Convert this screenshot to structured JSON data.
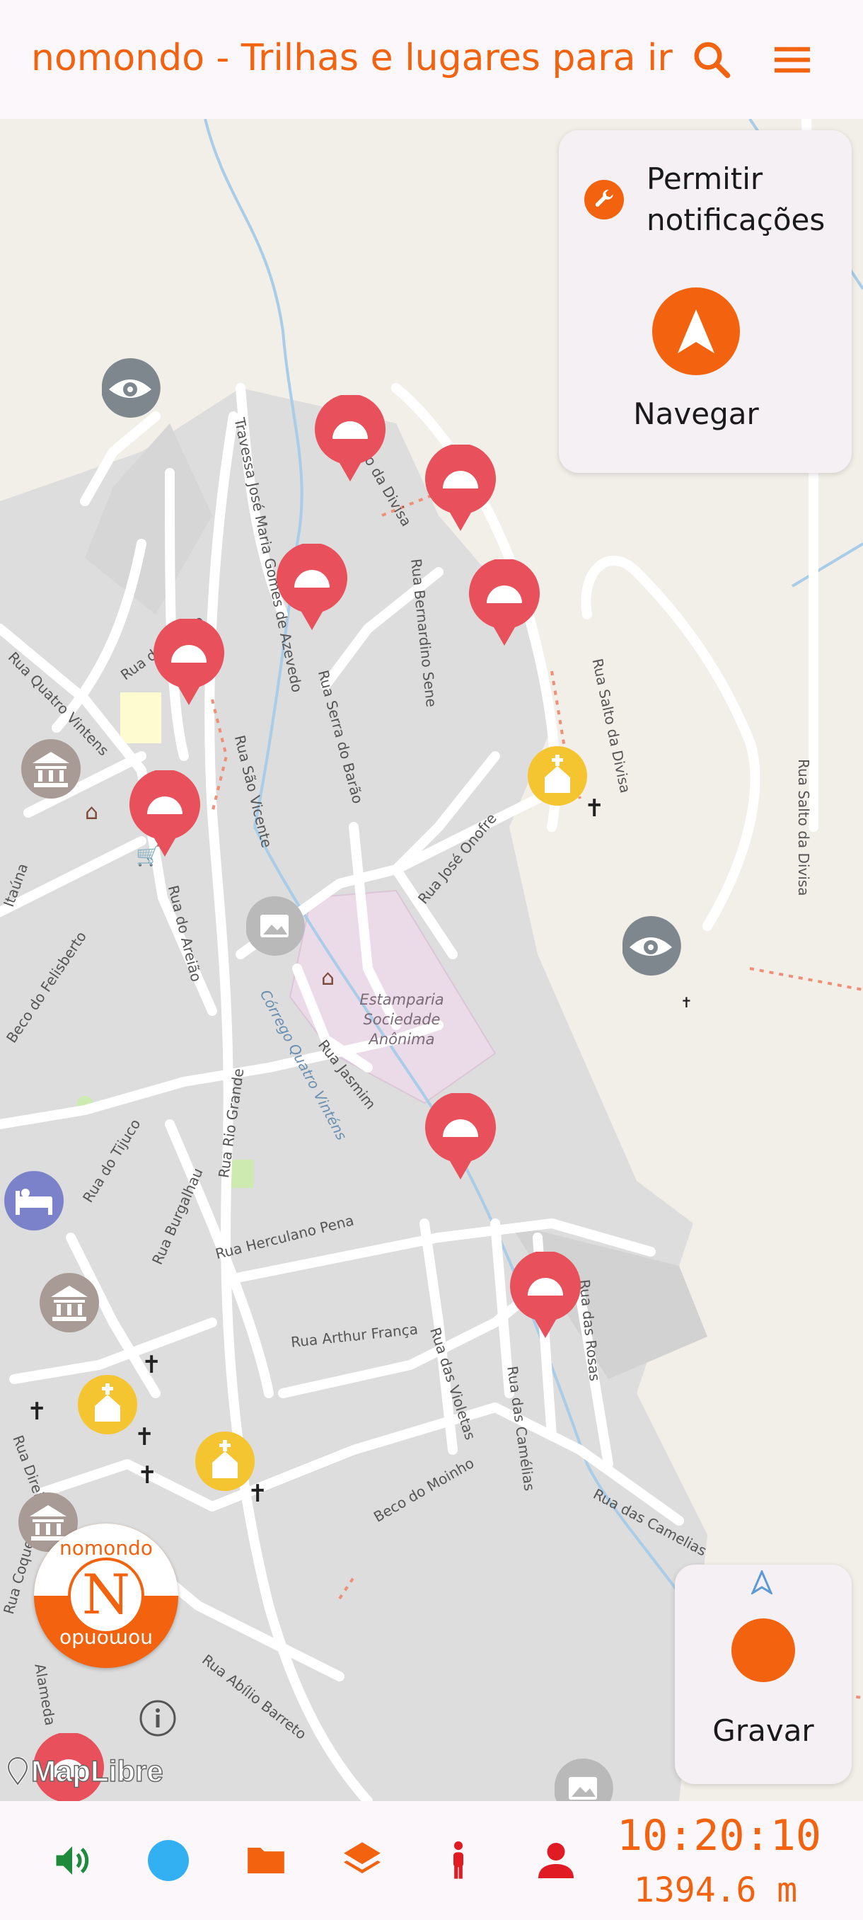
{
  "header": {
    "title": "nomondo - Trilhas e lugares para ir",
    "search_icon": "search-icon",
    "menu_icon": "menu-icon"
  },
  "colors": {
    "accent": "#f2620f",
    "pin_red": "#e8505b",
    "poi_yellow": "#f5c431",
    "sound_green": "#1e8a3c",
    "dot_blue": "#33b0f2",
    "person_red": "#e01b24"
  },
  "panels": {
    "notifications_label": "Permitir notificações",
    "navigate_label": "Navegar",
    "record_label": "Gravar"
  },
  "map": {
    "streets": [
      "Rua Salto da Divisa",
      "Rua Salto da Divisa",
      "Rua Salto da Divisa",
      "Travessa José Maria Gomes de Azevedo",
      "Rua Bernardino Sene",
      "Rua do Areião",
      "Rua Quatro Vintens",
      "Rua São Vicente",
      "Rua Serra do Barão",
      "Rua do Areião",
      "Rua José Onofre",
      "Rua Jasmim",
      "Córrego Quatro Vinténs",
      "Rua do Tijuco",
      "Rua Rio Grande",
      "Rua Burgalhau",
      "Rua Herculano Pena",
      "Rua Arthur França",
      "Rua das Violetas",
      "Rua das Camélias",
      "Rua das Rosas",
      "Beco do Moinho",
      "Rua das Camelias",
      "Rua Abílio Barreto",
      "Rua Direita",
      "Rua Coqueiros",
      "Alameda",
      "Beco do Felisberto",
      "Itaúna"
    ],
    "area_label": "Estamparia Sociedade Anônima",
    "attribution": "MapLibre",
    "brand_badge_top": "nomondo",
    "brand_badge_bottom": "nomondo",
    "brand_letter": "N"
  },
  "status": {
    "time": "10:20:10",
    "distance": "1394.6 m"
  },
  "bottom_icons": [
    "sound-icon",
    "location-dot-icon",
    "folder-icon",
    "layers-icon",
    "person-walk-icon",
    "user-icon"
  ]
}
